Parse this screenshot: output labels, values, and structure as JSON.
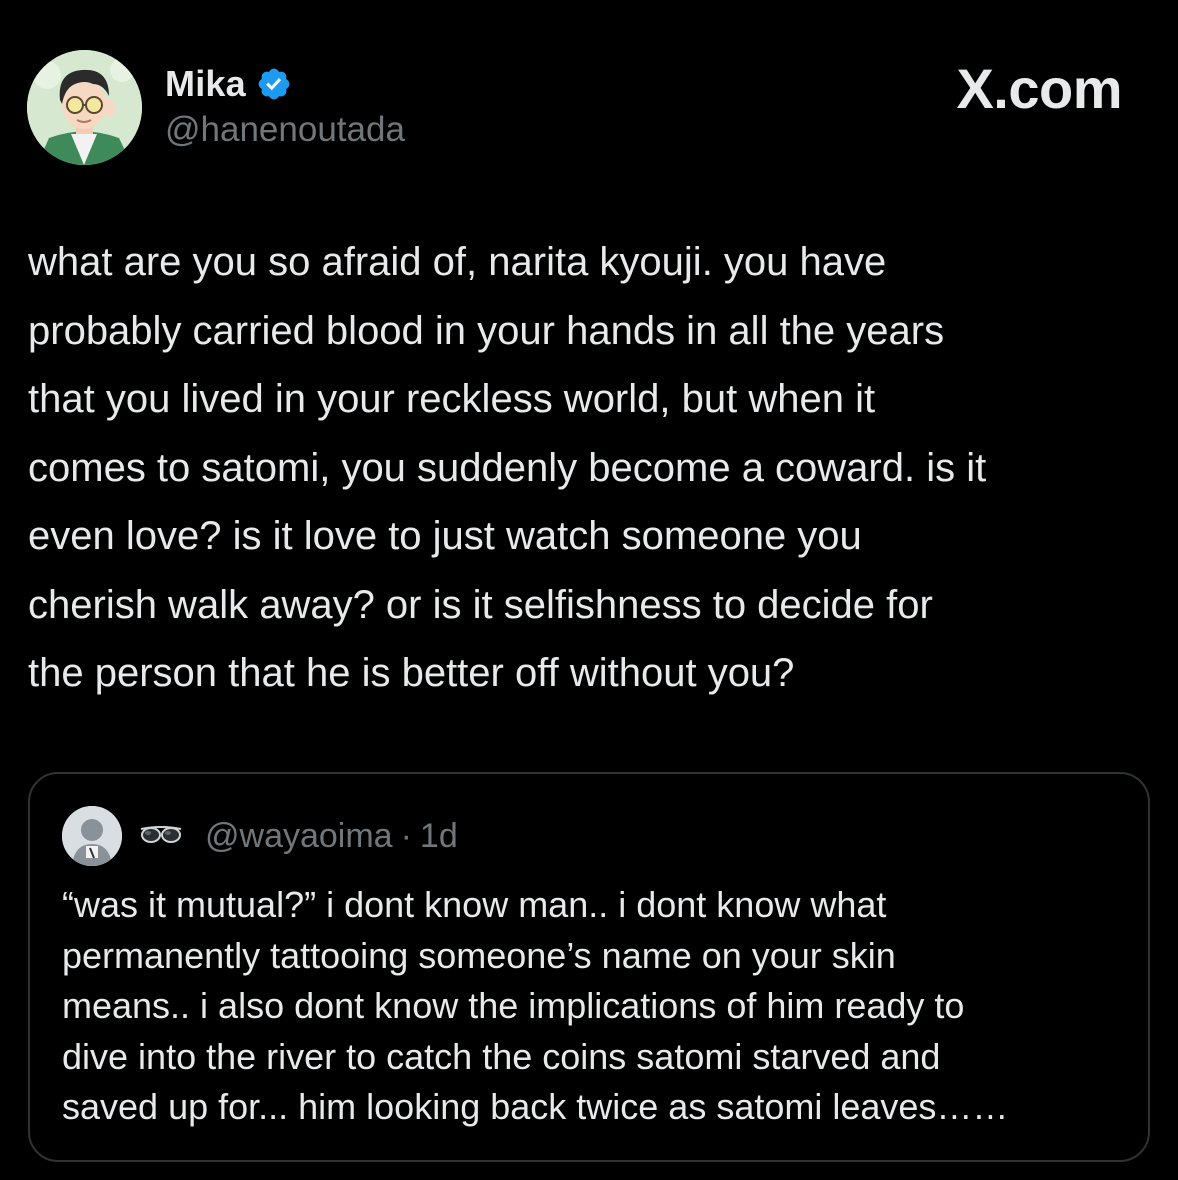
{
  "author": {
    "name": "Mika",
    "handle": "@hanenoutada",
    "verified": true
  },
  "brand": "X.com",
  "tweet": {
    "text": "what are you so afraid of, narita kyouji. you have\nprobably carried blood in your hands in all the years\nthat you lived in your reckless world, but when it\ncomes to satomi, you suddenly become a coward. is it\neven love? is it love to just watch someone you\ncherish walk away? or is it selfishness to decide for\nthe person that he is better off without you?"
  },
  "quote": {
    "handle": "@wayaoima",
    "separator": "·",
    "time": "1d",
    "name_icon": "sunglasses-icon",
    "text": "“was it mutual?” i dont know man.. i dont know what\npermanently tattooing someone’s name on your skin\nmeans.. i also dont know the implications of him ready to\ndive into the river to catch the coins satomi starved and\nsaved up for... him looking back twice as satomi leaves……"
  },
  "colors": {
    "background": "#000000",
    "text_primary": "#e7e9ea",
    "text_secondary": "#71767b",
    "verified_blue": "#1d9bf0",
    "card_border": "#2f3336"
  }
}
